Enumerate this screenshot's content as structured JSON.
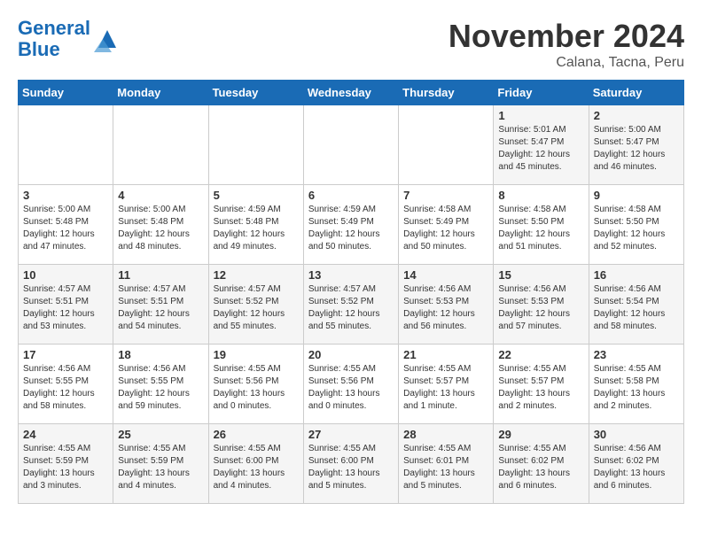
{
  "header": {
    "logo_line1": "General",
    "logo_line2": "Blue",
    "month_title": "November 2024",
    "location": "Calana, Tacna, Peru"
  },
  "days_of_week": [
    "Sunday",
    "Monday",
    "Tuesday",
    "Wednesday",
    "Thursday",
    "Friday",
    "Saturday"
  ],
  "weeks": [
    [
      {
        "day": "",
        "info": ""
      },
      {
        "day": "",
        "info": ""
      },
      {
        "day": "",
        "info": ""
      },
      {
        "day": "",
        "info": ""
      },
      {
        "day": "",
        "info": ""
      },
      {
        "day": "1",
        "info": "Sunrise: 5:01 AM\nSunset: 5:47 PM\nDaylight: 12 hours and 45 minutes."
      },
      {
        "day": "2",
        "info": "Sunrise: 5:00 AM\nSunset: 5:47 PM\nDaylight: 12 hours and 46 minutes."
      }
    ],
    [
      {
        "day": "3",
        "info": "Sunrise: 5:00 AM\nSunset: 5:48 PM\nDaylight: 12 hours and 47 minutes."
      },
      {
        "day": "4",
        "info": "Sunrise: 5:00 AM\nSunset: 5:48 PM\nDaylight: 12 hours and 48 minutes."
      },
      {
        "day": "5",
        "info": "Sunrise: 4:59 AM\nSunset: 5:48 PM\nDaylight: 12 hours and 49 minutes."
      },
      {
        "day": "6",
        "info": "Sunrise: 4:59 AM\nSunset: 5:49 PM\nDaylight: 12 hours and 50 minutes."
      },
      {
        "day": "7",
        "info": "Sunrise: 4:58 AM\nSunset: 5:49 PM\nDaylight: 12 hours and 50 minutes."
      },
      {
        "day": "8",
        "info": "Sunrise: 4:58 AM\nSunset: 5:50 PM\nDaylight: 12 hours and 51 minutes."
      },
      {
        "day": "9",
        "info": "Sunrise: 4:58 AM\nSunset: 5:50 PM\nDaylight: 12 hours and 52 minutes."
      }
    ],
    [
      {
        "day": "10",
        "info": "Sunrise: 4:57 AM\nSunset: 5:51 PM\nDaylight: 12 hours and 53 minutes."
      },
      {
        "day": "11",
        "info": "Sunrise: 4:57 AM\nSunset: 5:51 PM\nDaylight: 12 hours and 54 minutes."
      },
      {
        "day": "12",
        "info": "Sunrise: 4:57 AM\nSunset: 5:52 PM\nDaylight: 12 hours and 55 minutes."
      },
      {
        "day": "13",
        "info": "Sunrise: 4:57 AM\nSunset: 5:52 PM\nDaylight: 12 hours and 55 minutes."
      },
      {
        "day": "14",
        "info": "Sunrise: 4:56 AM\nSunset: 5:53 PM\nDaylight: 12 hours and 56 minutes."
      },
      {
        "day": "15",
        "info": "Sunrise: 4:56 AM\nSunset: 5:53 PM\nDaylight: 12 hours and 57 minutes."
      },
      {
        "day": "16",
        "info": "Sunrise: 4:56 AM\nSunset: 5:54 PM\nDaylight: 12 hours and 58 minutes."
      }
    ],
    [
      {
        "day": "17",
        "info": "Sunrise: 4:56 AM\nSunset: 5:55 PM\nDaylight: 12 hours and 58 minutes."
      },
      {
        "day": "18",
        "info": "Sunrise: 4:56 AM\nSunset: 5:55 PM\nDaylight: 12 hours and 59 minutes."
      },
      {
        "day": "19",
        "info": "Sunrise: 4:55 AM\nSunset: 5:56 PM\nDaylight: 13 hours and 0 minutes."
      },
      {
        "day": "20",
        "info": "Sunrise: 4:55 AM\nSunset: 5:56 PM\nDaylight: 13 hours and 0 minutes."
      },
      {
        "day": "21",
        "info": "Sunrise: 4:55 AM\nSunset: 5:57 PM\nDaylight: 13 hours and 1 minute."
      },
      {
        "day": "22",
        "info": "Sunrise: 4:55 AM\nSunset: 5:57 PM\nDaylight: 13 hours and 2 minutes."
      },
      {
        "day": "23",
        "info": "Sunrise: 4:55 AM\nSunset: 5:58 PM\nDaylight: 13 hours and 2 minutes."
      }
    ],
    [
      {
        "day": "24",
        "info": "Sunrise: 4:55 AM\nSunset: 5:59 PM\nDaylight: 13 hours and 3 minutes."
      },
      {
        "day": "25",
        "info": "Sunrise: 4:55 AM\nSunset: 5:59 PM\nDaylight: 13 hours and 4 minutes."
      },
      {
        "day": "26",
        "info": "Sunrise: 4:55 AM\nSunset: 6:00 PM\nDaylight: 13 hours and 4 minutes."
      },
      {
        "day": "27",
        "info": "Sunrise: 4:55 AM\nSunset: 6:00 PM\nDaylight: 13 hours and 5 minutes."
      },
      {
        "day": "28",
        "info": "Sunrise: 4:55 AM\nSunset: 6:01 PM\nDaylight: 13 hours and 5 minutes."
      },
      {
        "day": "29",
        "info": "Sunrise: 4:55 AM\nSunset: 6:02 PM\nDaylight: 13 hours and 6 minutes."
      },
      {
        "day": "30",
        "info": "Sunrise: 4:56 AM\nSunset: 6:02 PM\nDaylight: 13 hours and 6 minutes."
      }
    ]
  ]
}
